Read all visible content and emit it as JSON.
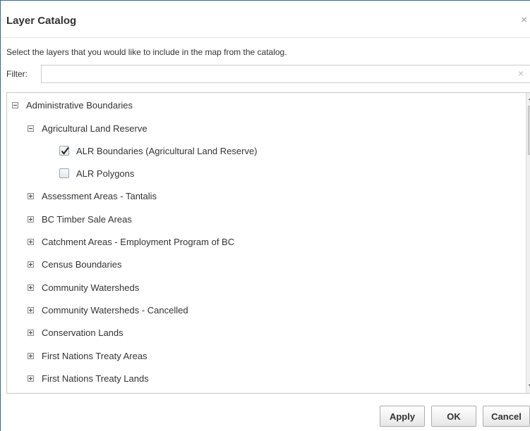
{
  "dialog": {
    "title": "Layer Catalog",
    "close_glyph": "×",
    "instruction": "Select the layers that you would like to include in the map from the catalog.",
    "filter": {
      "label": "Filter:",
      "value": "",
      "placeholder": "",
      "clear_glyph": "×"
    },
    "tree": {
      "root": {
        "label": "Administrative Boundaries",
        "expanded": true,
        "children": [
          {
            "label": "Agricultural Land Reserve",
            "expanded": true,
            "layers": [
              {
                "label": "ALR Boundaries (Agricultural Land Reserve)",
                "checked": true
              },
              {
                "label": "ALR Polygons",
                "checked": false
              }
            ]
          },
          {
            "label": "Assessment Areas - Tantalis",
            "expanded": false
          },
          {
            "label": "BC Timber Sale Areas",
            "expanded": false
          },
          {
            "label": "Catchment Areas - Employment Program of BC",
            "expanded": false
          },
          {
            "label": "Census Boundaries",
            "expanded": false
          },
          {
            "label": "Community Watersheds",
            "expanded": false
          },
          {
            "label": "Community Watersheds - Cancelled",
            "expanded": false
          },
          {
            "label": "Conservation Lands",
            "expanded": false
          },
          {
            "label": "First Nations Treaty Areas",
            "expanded": false
          },
          {
            "label": "First Nations Treaty Lands",
            "expanded": false
          }
        ]
      }
    },
    "buttons": {
      "apply": "Apply",
      "ok": "OK",
      "cancel": "Cancel"
    },
    "colors": {
      "border_accent": "#2b6aa6",
      "button_text": "#333333"
    }
  }
}
